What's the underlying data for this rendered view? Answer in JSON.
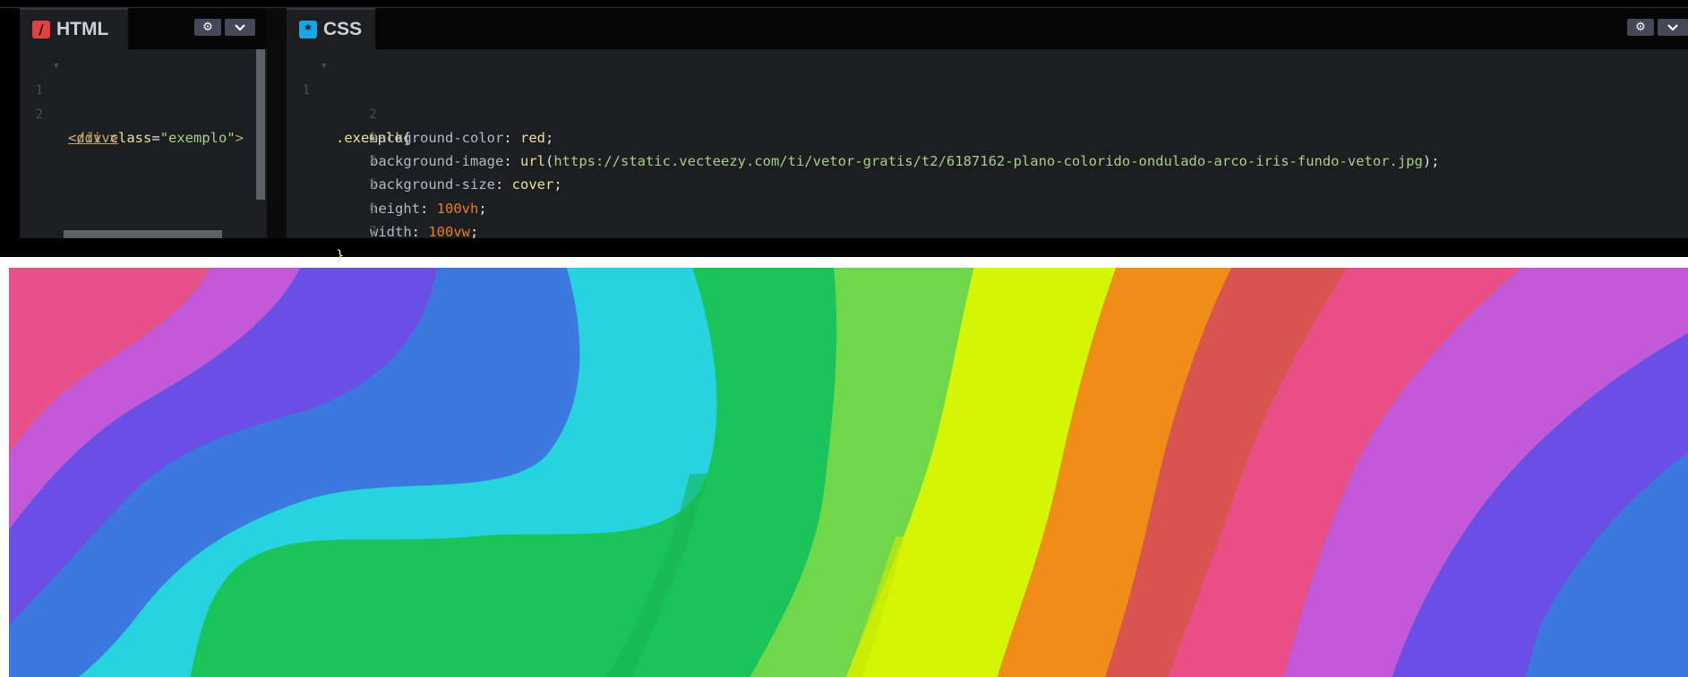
{
  "html_panel": {
    "tab_label": "HTML",
    "tab_icon": "html-slash-icon",
    "icon_glyph": "/",
    "settings_icon": "gear-icon",
    "collapse_icon": "chevron-down-icon",
    "lines": [
      {
        "num": "1",
        "parts": [
          "<div ",
          "class",
          "=",
          "\"exemplo\"",
          ">"
        ]
      },
      {
        "num": "2",
        "parts": [
          "</div>"
        ]
      }
    ]
  },
  "css_panel": {
    "tab_label": "CSS",
    "tab_icon": "css-asterisk-icon",
    "icon_glyph": "*",
    "settings_icon": "gear-icon",
    "collapse_icon": "chevron-down-icon",
    "lines": [
      {
        "num": "1",
        "selector": ".exemplo",
        "brace": "{"
      },
      {
        "num": "2",
        "prop": "background-color",
        "value": "red"
      },
      {
        "num": "3",
        "prop": "background-image",
        "func": "url",
        "url": "https://static.vecteezy.com/ti/vetor-gratis/t2/6187162-plano-colorido-ondulado-arco-iris-fundo-vetor.jpg"
      },
      {
        "num": "4",
        "prop": "background-size",
        "value": "cover"
      },
      {
        "num": "5",
        "prop": "height",
        "num_value": "100vh"
      },
      {
        "num": "6",
        "prop": "width",
        "num_value": "100vw"
      },
      {
        "num": "7",
        "brace": "}"
      }
    ]
  },
  "colors": {
    "editor_bg": "#1d1e22",
    "html_icon": "#e14143",
    "css_icon": "#17a7e8",
    "rainbow": [
      "#e8508a",
      "#c358d9",
      "#6a4ee6",
      "#3b78e0",
      "#26d3de",
      "#1ac45a",
      "#6fd84a",
      "#d4f605",
      "#f08c18",
      "#d9544e",
      "#ea4e86"
    ]
  },
  "output": {
    "description_image": "rainbow-wave-background"
  }
}
